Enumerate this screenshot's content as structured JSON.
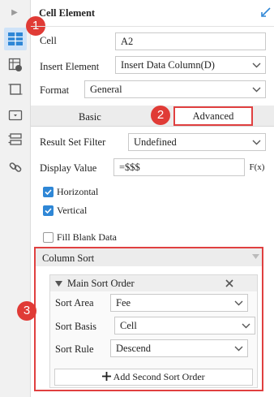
{
  "header": {
    "title": "Cell Element"
  },
  "fields": {
    "cell_label": "Cell",
    "cell_value": "A2",
    "insert_label": "Insert Element",
    "insert_value": "Insert Data Column(D)",
    "format_label": "Format",
    "format_value": "General"
  },
  "tabs": {
    "basic": "Basic",
    "advanced": "Advanced"
  },
  "advanced": {
    "filter_label": "Result Set Filter",
    "filter_value": "Undefined",
    "display_label": "Display Value",
    "display_value": "=$$$",
    "fx_label": "F(x)",
    "horizontal": "Horizontal",
    "vertical": "Vertical",
    "fill_blank": "Fill Blank Data"
  },
  "checkboxes": {
    "horizontal": true,
    "vertical": true,
    "fill_blank": false
  },
  "column_sort": {
    "title": "Column Sort",
    "main_title": "Main Sort Order",
    "area_label": "Sort Area",
    "area_value": "Fee",
    "basis_label": "Sort Basis",
    "basis_value": "Cell",
    "rule_label": "Sort Rule",
    "rule_value": "Descend",
    "add_label": "Add Second Sort Order"
  },
  "badges": {
    "one": "1",
    "two": "2",
    "three": "3"
  },
  "colors": {
    "highlight_border": "#e04040",
    "badge": "#e03b36",
    "accent": "#2f87d6",
    "active_tool": "#cfe3f8"
  },
  "icons": [
    "expand-arrow-icon",
    "cell-element-icon",
    "cell-attribute-icon",
    "border-frame-icon",
    "widget-icon",
    "condition-attribute-icon",
    "hyperlink-icon",
    "pin-icon",
    "chevron-down-icon",
    "collapse-triangle-icon",
    "close-icon",
    "plus-icon"
  ]
}
